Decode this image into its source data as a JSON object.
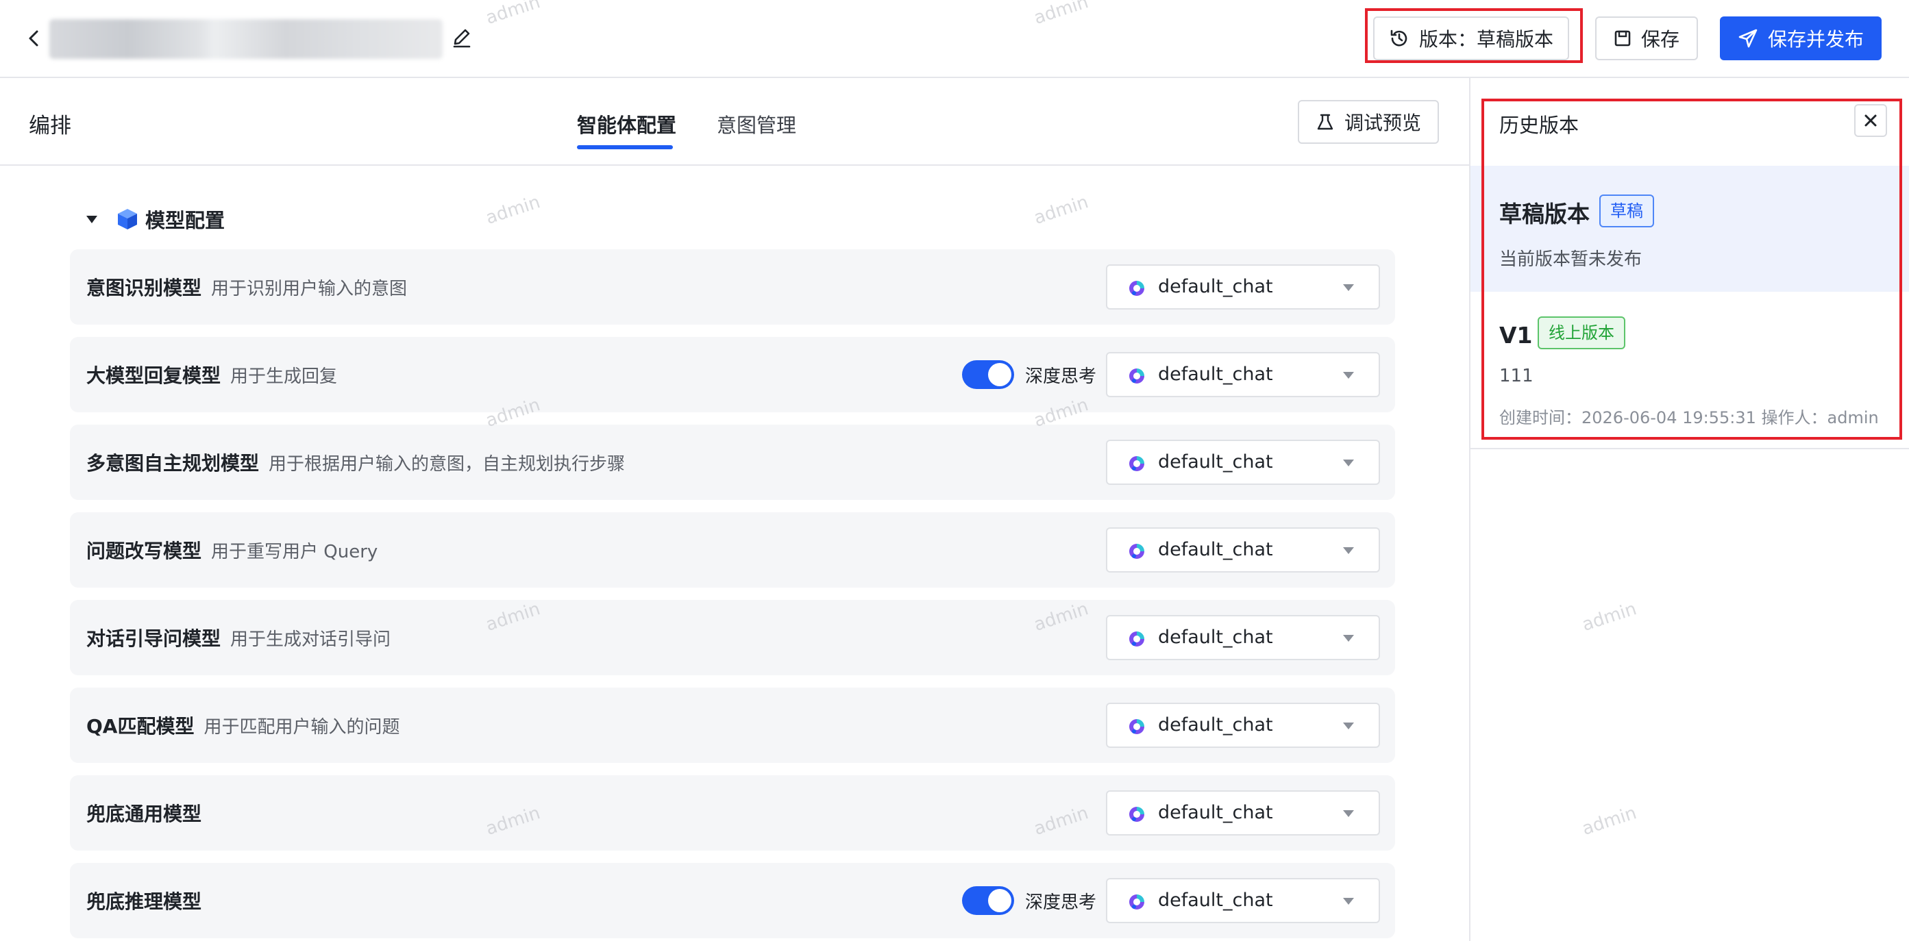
{
  "header": {
    "version_button_label": "版本：草稿版本",
    "save_label": "保存",
    "save_publish_label": "保存并发布"
  },
  "subheader": {
    "title": "编排",
    "tabs": [
      {
        "label": "智能体配置",
        "active": true
      },
      {
        "label": "意图管理",
        "active": false
      }
    ],
    "debug_button_label": "调试预览"
  },
  "section": {
    "title": "模型配置",
    "rows": [
      {
        "name": "意图识别模型",
        "desc": "用于识别用户输入的意图",
        "deep_think": false,
        "value": "default_chat"
      },
      {
        "name": "大模型回复模型",
        "desc": "用于生成回复",
        "deep_think": true,
        "value": "default_chat"
      },
      {
        "name": "多意图自主规划模型",
        "desc": "用于根据用户输入的意图，自主规划执行步骤",
        "deep_think": false,
        "value": "default_chat"
      },
      {
        "name": "问题改写模型",
        "desc": "用于重写用户 Query",
        "deep_think": false,
        "value": "default_chat"
      },
      {
        "name": "对话引导问模型",
        "desc": "用于生成对话引导问",
        "deep_think": false,
        "value": "default_chat"
      },
      {
        "name": "QA匹配模型",
        "desc": "用于匹配用户输入的问题",
        "deep_think": false,
        "value": "default_chat"
      },
      {
        "name": "兜底通用模型",
        "desc": "",
        "deep_think": false,
        "value": "default_chat"
      },
      {
        "name": "兜底推理模型",
        "desc": "",
        "deep_think": true,
        "value": "default_chat"
      }
    ],
    "deep_think_label": "深度思考"
  },
  "history": {
    "title": "历史版本",
    "versions": [
      {
        "name": "草稿版本",
        "tag": "草稿",
        "desc": "当前版本暂未发布"
      },
      {
        "name": "V1",
        "tag": "线上版本",
        "desc": "111",
        "meta": "创建时间：2026-06-04 19:55:31    操作人：admin"
      }
    ]
  },
  "watermark_text": "admin",
  "colors": {
    "primary": "#1f5cf3",
    "highlight": "#e5212b",
    "online_tag": "#21a336"
  }
}
